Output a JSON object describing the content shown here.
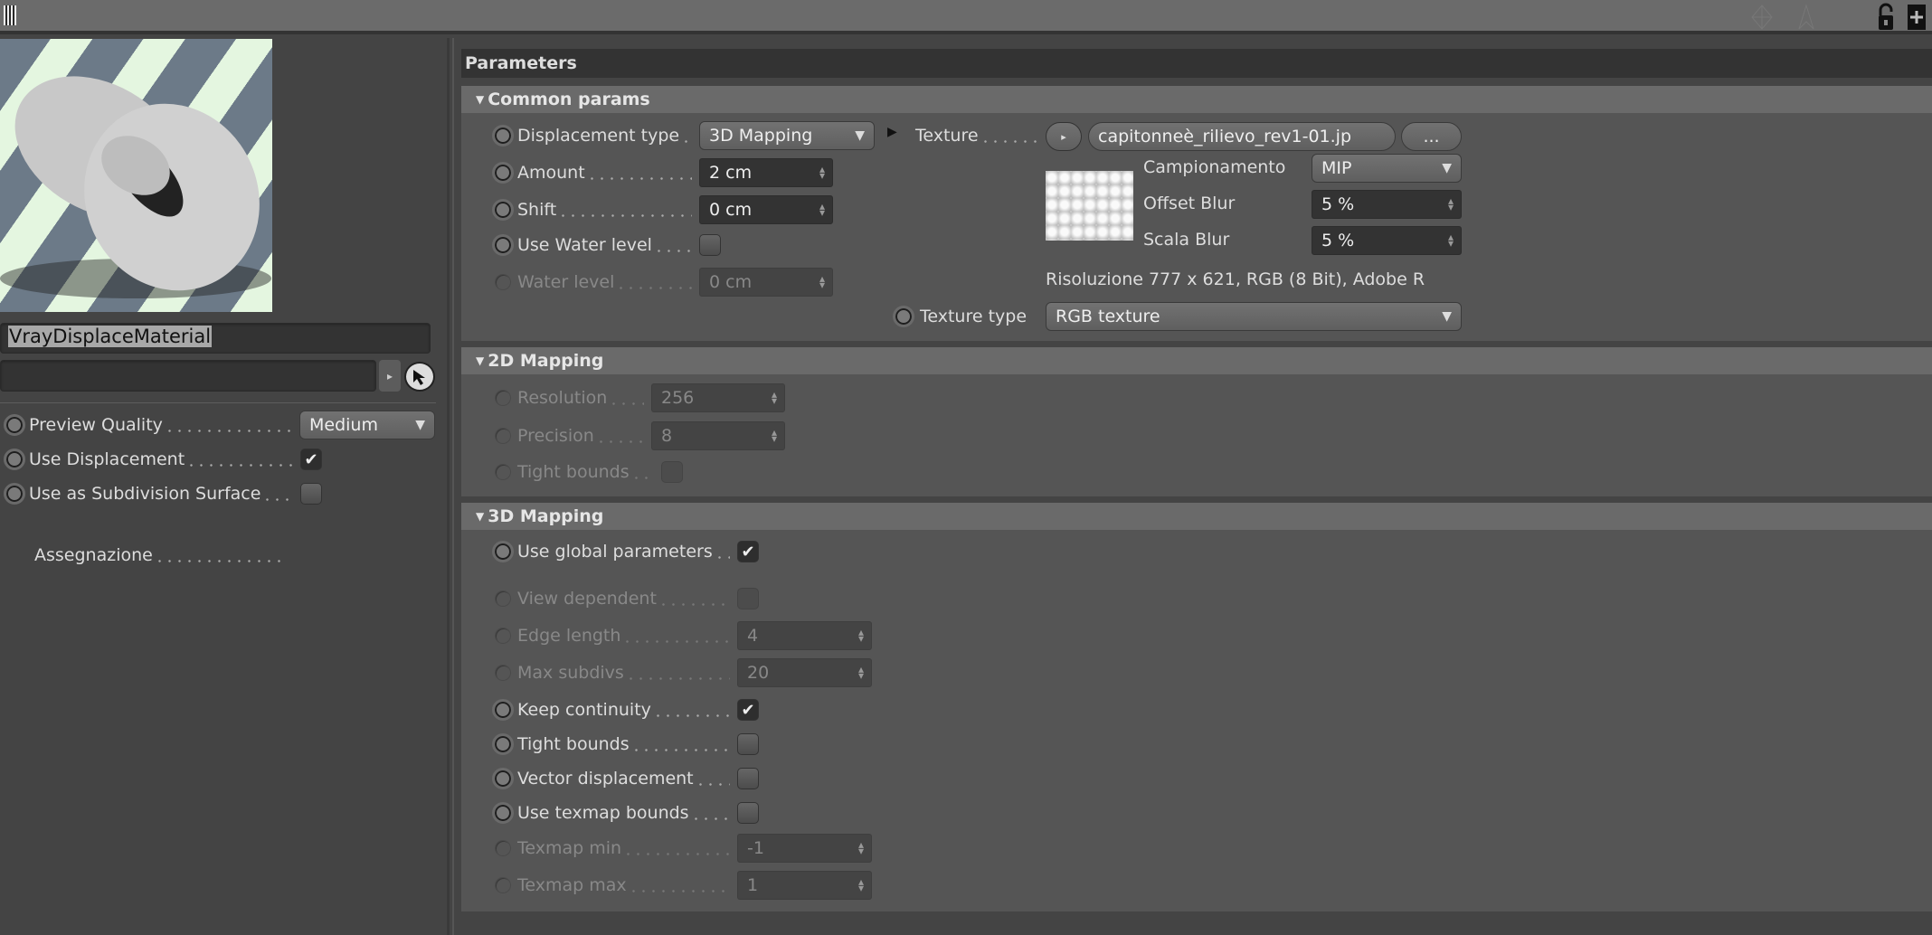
{
  "toolbar": {
    "icons": [
      "grid-pattern-icon",
      "axis-icon",
      "pin-icon",
      "unlock-icon",
      "new-panel-icon"
    ]
  },
  "material": {
    "name": "VrayDisplaceMaterial",
    "link_value": ""
  },
  "left_params": [
    {
      "label": "Preview Quality",
      "control": "dropdown",
      "value": "Medium",
      "enabled": true
    },
    {
      "label": "Use Displacement",
      "control": "checkbox",
      "checked": true,
      "enabled": true
    },
    {
      "label": "Use as Subdivision Surface",
      "control": "checkbox",
      "checked": false,
      "enabled": true
    }
  ],
  "assignment_label": "Assegnazione",
  "panel_title": "Parameters",
  "sections": [
    {
      "title": "Common params",
      "rows": [
        {
          "label": "Displacement type",
          "control": "dropdown",
          "value": "3D Mapping",
          "enabled": true
        },
        {
          "label": "Amount",
          "control": "number",
          "value": "2 cm",
          "enabled": true
        },
        {
          "label": "Shift",
          "control": "number",
          "value": "0 cm",
          "enabled": true
        },
        {
          "label": "Use Water level",
          "control": "checkbox",
          "checked": false,
          "enabled": true
        },
        {
          "label": "Water level",
          "control": "number",
          "value": "0 cm",
          "enabled": false
        }
      ]
    },
    {
      "title": "2D Mapping",
      "rows": [
        {
          "label": "Resolution",
          "control": "number",
          "value": "256",
          "enabled": false
        },
        {
          "label": "Precision",
          "control": "number",
          "value": "8",
          "enabled": false
        },
        {
          "label": "Tight bounds",
          "control": "checkbox",
          "checked": false,
          "enabled": false
        }
      ]
    },
    {
      "title": "3D Mapping",
      "rows": [
        {
          "label": "Use global parameters",
          "control": "checkbox",
          "checked": true,
          "enabled": true
        },
        {
          "label": "View dependent",
          "control": "checkbox",
          "checked": false,
          "enabled": false
        },
        {
          "label": "Edge length",
          "control": "number",
          "value": "4",
          "enabled": false
        },
        {
          "label": "Max subdivs",
          "control": "number",
          "value": "20",
          "enabled": false
        },
        {
          "label": "Keep continuity",
          "control": "checkbox",
          "checked": true,
          "enabled": true
        },
        {
          "label": "Tight bounds",
          "control": "checkbox",
          "checked": false,
          "enabled": true
        },
        {
          "label": "Vector displacement",
          "control": "checkbox",
          "checked": false,
          "enabled": true
        },
        {
          "label": "Use texmap bounds",
          "control": "checkbox",
          "checked": false,
          "enabled": true
        },
        {
          "label": "Texmap min",
          "control": "number",
          "value": "-1",
          "enabled": false
        },
        {
          "label": "Texmap max",
          "control": "number",
          "value": "1",
          "enabled": false
        }
      ]
    }
  ],
  "texture": {
    "label": "Texture",
    "filename": "capitonneè_rilievo_rev1-01.jp",
    "browse_label": "...",
    "sampling_label": "Campionamento",
    "sampling_value": "MIP",
    "offset_blur_label": "Offset Blur",
    "offset_blur_value": "5 %",
    "scale_blur_label": "Scala Blur",
    "scale_blur_value": "5 %",
    "resolution_info": "Risoluzione 777 x 621, RGB (8 Bit), Adobe R",
    "texture_type_label": "Texture type",
    "texture_type_value": "RGB texture"
  }
}
